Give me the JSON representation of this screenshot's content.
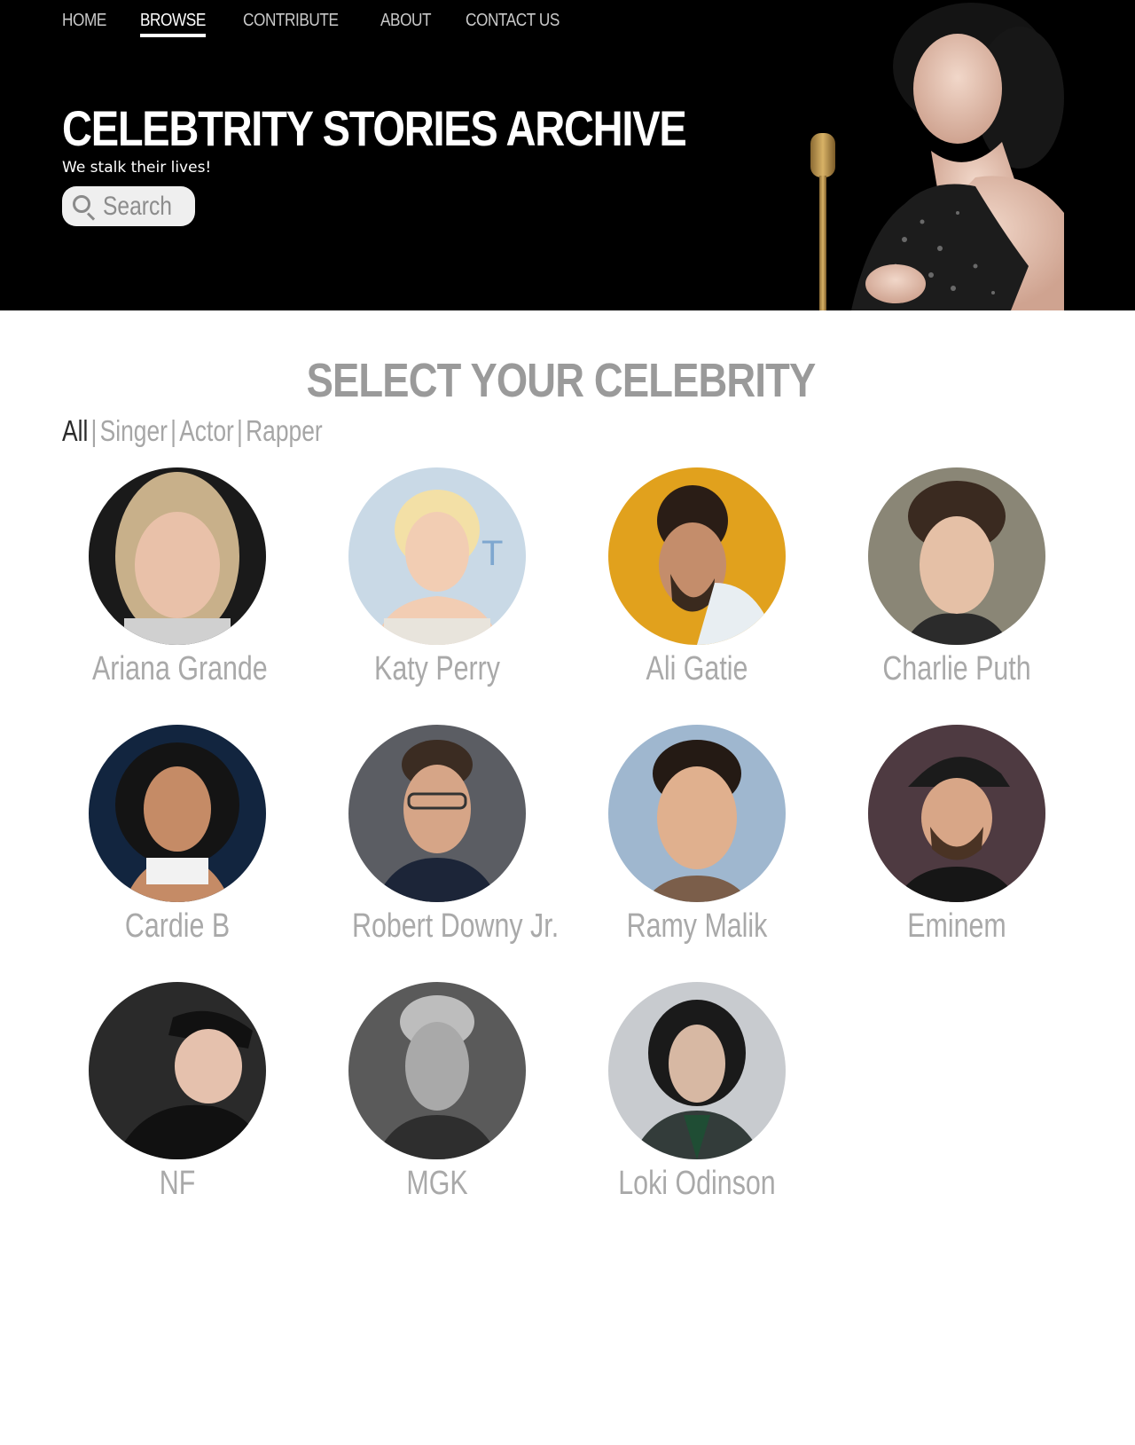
{
  "nav": {
    "items": [
      {
        "label": "HOME",
        "active": false
      },
      {
        "label": "BROWSE",
        "active": true
      },
      {
        "label": "CONTRIBUTE",
        "active": false
      },
      {
        "label": "ABOUT",
        "active": false
      },
      {
        "label": "CONTACT US",
        "active": false
      }
    ]
  },
  "hero": {
    "title": "CELEBTRITY STORIES ARCHIVE",
    "tagline": "We stalk their lives!",
    "search_placeholder": "Search"
  },
  "main": {
    "heading": "SELECT YOUR CELEBRITY",
    "filters": [
      {
        "label": "All",
        "active": true
      },
      {
        "label": "Singer",
        "active": false
      },
      {
        "label": "Actor",
        "active": false
      },
      {
        "label": "Rapper",
        "active": false
      }
    ],
    "filter_separator": "|",
    "celebrities": [
      {
        "name": "Ariana Grande"
      },
      {
        "name": "Katy Perry"
      },
      {
        "name": "Ali Gatie"
      },
      {
        "name": "Charlie Puth"
      },
      {
        "name": "Cardie B"
      },
      {
        "name": "Robert Downy Jr."
      },
      {
        "name": "Ramy Malik"
      },
      {
        "name": "Eminem"
      },
      {
        "name": "NF"
      },
      {
        "name": "MGK"
      },
      {
        "name": "Loki Odinson"
      }
    ]
  }
}
